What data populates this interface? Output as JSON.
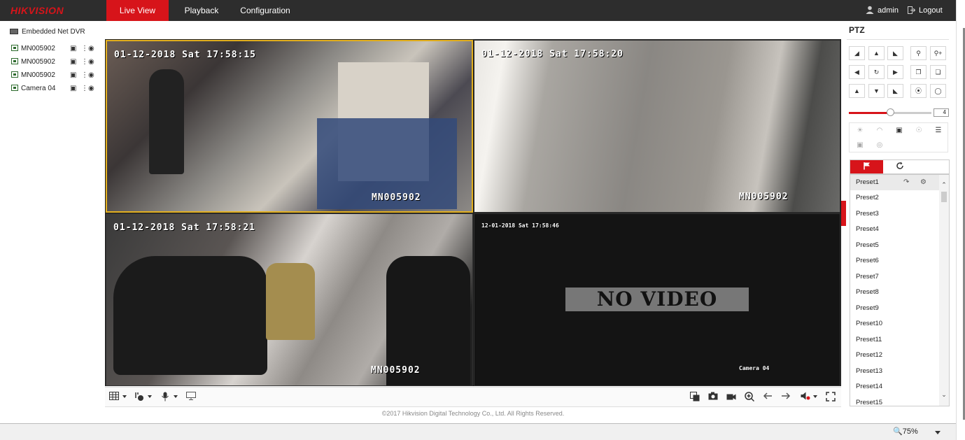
{
  "header": {
    "logo": "HIKVISION",
    "tabs": [
      {
        "label": "Live View",
        "active": true
      },
      {
        "label": "Playback",
        "active": false
      },
      {
        "label": "Configuration",
        "active": false
      }
    ],
    "user": "admin",
    "logout": "Logout"
  },
  "colors": {
    "brand_red": "#d7141a",
    "topbar": "#2d2d2d",
    "selected_tile_border": "#e3b020"
  },
  "device_tree": {
    "root": "Embedded Net DVR",
    "cameras": [
      "MN005902",
      "MN005902",
      "MN005902",
      "Camera 04"
    ]
  },
  "tiles": [
    {
      "osd_time": "01-12-2018 Sat 17:58:15",
      "osd_name": "MN005902",
      "selected": true
    },
    {
      "osd_time": "01-12-2018 Sat 17:58:20",
      "osd_name": "MN005902",
      "selected": false
    },
    {
      "osd_time": "01-12-2018 Sat 17:58:21",
      "osd_name": "MN005902",
      "selected": false
    },
    {
      "osd_time": "12-01-2018 Sat 17:58:46",
      "osd_name": "Camera 04",
      "status": "NO VIDEO",
      "selected": false
    }
  ],
  "toolbar": {
    "left": [
      "layout-icon",
      "stream-icon",
      "microphone-icon",
      "monitor-icon"
    ],
    "right": [
      "capture-all-icon",
      "camera-snapshot-icon",
      "record-icon",
      "zoom-in-icon",
      "prev-page-icon",
      "next-page-icon",
      "volume-icon",
      "fullscreen-icon"
    ]
  },
  "copyright": "©2017 Hikvision Digital Technology Co., Ltd. All Rights Reserved.",
  "ptz": {
    "title": "PTZ",
    "speed": "4",
    "speed_fraction": 0.5,
    "presets": [
      "Preset1",
      "Preset2",
      "Preset3",
      "Preset4",
      "Preset5",
      "Preset6",
      "Preset7",
      "Preset8",
      "Preset9",
      "Preset10",
      "Preset11",
      "Preset12",
      "Preset13",
      "Preset14",
      "Preset15"
    ]
  },
  "status": {
    "zoom": "75%"
  }
}
